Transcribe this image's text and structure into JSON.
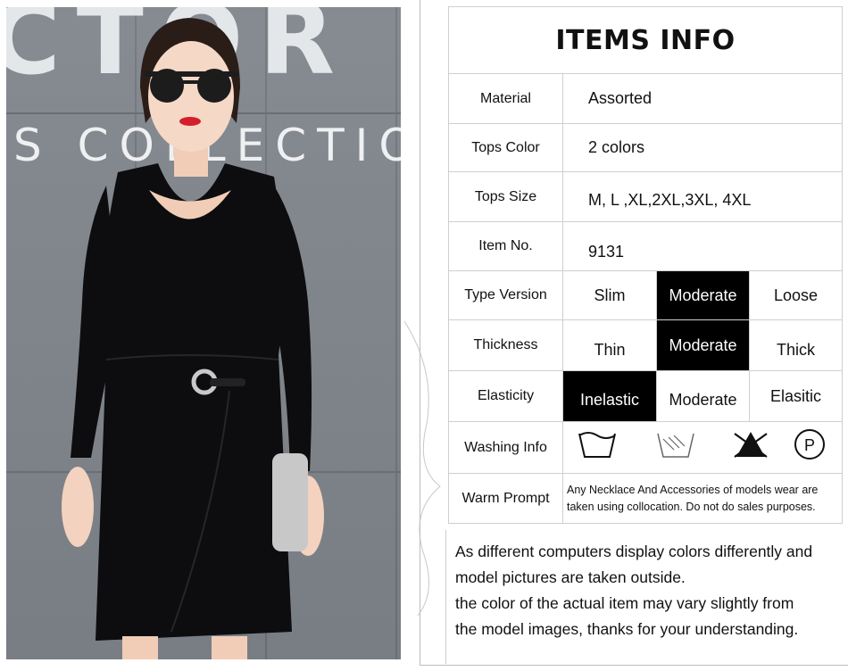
{
  "items_info": {
    "title": "ITEMS INFO",
    "rows": {
      "material": {
        "label": "Material",
        "value": "Assorted"
      },
      "tops_color": {
        "label": "Tops Color",
        "value": "2 colors"
      },
      "tops_size": {
        "label": "Tops Size",
        "value": "M, L ,XL,2XL,3XL, 4XL"
      },
      "item_no": {
        "label": "Item No.",
        "value": "9131"
      }
    },
    "type_version": {
      "label": "Type Version",
      "options": [
        "Slim",
        "Moderate",
        "Loose"
      ],
      "selected": "Moderate"
    },
    "thickness": {
      "label": "Thickness",
      "options": [
        "Thin",
        "Moderate",
        "Thick"
      ],
      "selected": "Moderate"
    },
    "elasticity": {
      "label": "Elasticity",
      "options": [
        "Inelastic",
        "Moderate",
        "Elasitic"
      ],
      "selected": "Inelastic"
    },
    "washing_info": {
      "label": "Washing Info",
      "icons": [
        "wash-tub-icon",
        "hand-wash-icon",
        "no-bleach-icon",
        "dry-clean-p-icon"
      ],
      "p_letter": "P"
    },
    "warm_prompt": {
      "label": "Warm Prompt",
      "text": "Any Necklace And Accessories of models wear are taken using collocation. Do not do sales purposes."
    }
  },
  "photo": {
    "wall_text_top": "CTOR",
    "wall_text": "S COLLECTION"
  },
  "note": {
    "line1": "As different computers display colors differently and",
    "line2": "model pictures are taken outside.",
    "line3": "the color of the actual item may vary slightly from",
    "line4": "the model images, thanks for your understanding."
  },
  "colors": {
    "selected_bg": "#000000",
    "dress": "#0d0d0f",
    "wall": "#7f848b"
  }
}
